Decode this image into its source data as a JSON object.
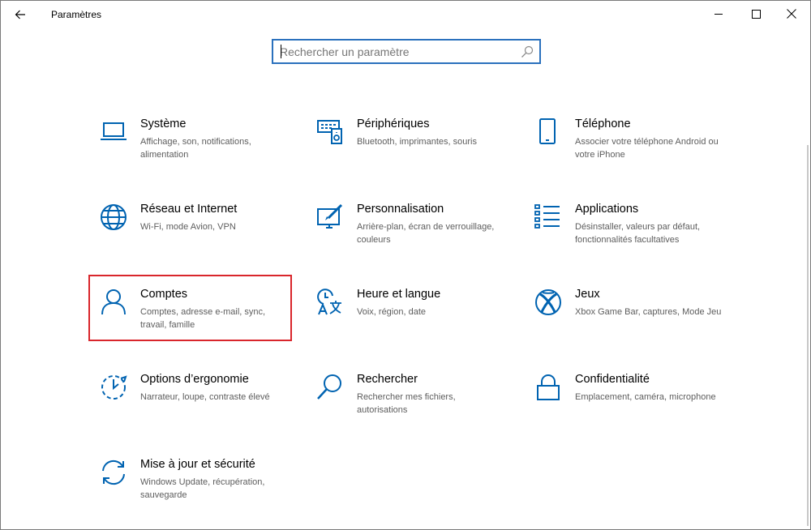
{
  "window": {
    "title": "Paramètres",
    "back_icon": "arrow-left-icon",
    "minimize_icon": "minimize-icon",
    "maximize_icon": "maximize-icon",
    "close_icon": "close-icon"
  },
  "search": {
    "placeholder": "Rechercher un paramètre",
    "value": "",
    "icon": "search-icon",
    "border_color": "#2b71bd"
  },
  "accent_color": "#0063b1",
  "highlight_color": "#d9262c",
  "tiles": [
    {
      "name": "Système",
      "description": "Affichage, son, notifications, alimentation",
      "icon": "laptop-icon"
    },
    {
      "name": "Périphériques",
      "description": "Bluetooth, imprimantes, souris",
      "icon": "devices-icon"
    },
    {
      "name": "Téléphone",
      "description": "Associer votre téléphone Android ou votre iPhone",
      "icon": "phone-icon"
    },
    {
      "name": "Réseau et Internet",
      "description": "Wi-Fi, mode Avion, VPN",
      "icon": "globe-icon"
    },
    {
      "name": "Personnalisation",
      "description": "Arrière-plan, écran de verrouillage, couleurs",
      "icon": "paint-brush-icon"
    },
    {
      "name": "Applications",
      "description": "Désinstaller, valeurs par défaut, fonctionnalités facultatives",
      "icon": "apps-list-icon"
    },
    {
      "name": "Comptes",
      "description": "Comptes, adresse e-mail, sync, travail, famille",
      "icon": "person-icon",
      "highlighted": true
    },
    {
      "name": "Heure et langue",
      "description": "Voix, région, date",
      "icon": "time-language-icon"
    },
    {
      "name": "Jeux",
      "description": "Xbox Game Bar, captures, Mode Jeu",
      "icon": "xbox-icon"
    },
    {
      "name": "Options d’ergonomie",
      "description": "Narrateur, loupe, contraste élevé",
      "icon": "ease-of-access-icon"
    },
    {
      "name": "Rechercher",
      "description": "Rechercher mes fichiers, autorisations",
      "icon": "magnifier-icon"
    },
    {
      "name": "Confidentialité",
      "description": "Emplacement, caméra, microphone",
      "icon": "lock-icon"
    },
    {
      "name": "Mise à jour et sécurité",
      "description": "Windows Update, récupération, sauvegarde",
      "icon": "update-sync-icon"
    }
  ]
}
